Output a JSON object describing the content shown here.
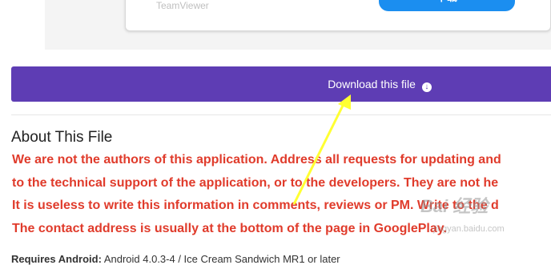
{
  "card": {
    "app_name": "TeamViewer",
    "button_label": "下载"
  },
  "download_bar": {
    "label": "Download this file",
    "icon": "circle-arrow-down-icon"
  },
  "about": {
    "title": "About This File",
    "notice_lines": [
      "We are not the authors of this application. Address all requests for updating and",
      "to the technical support of the application, or to the developers. They are not he",
      "It is useless to write this information in comments, reviews or PM. Write to the d",
      "The contact address is usually at the bottom of the page in GooglePlay."
    ],
    "requires_label": "Requires Android:",
    "requires_value": "Android 4.0.3-4 / Ice Cream Sandwich MR1 or later"
  },
  "annotation": {
    "arrow_color": "#ffff33"
  },
  "watermark": {
    "logo": "Bai 经验",
    "sub": "jingyan.baidu.com"
  },
  "colors": {
    "accent": "#5e3db4",
    "warning_text": "#e03b2b",
    "card_button": "#1b8ef0"
  }
}
